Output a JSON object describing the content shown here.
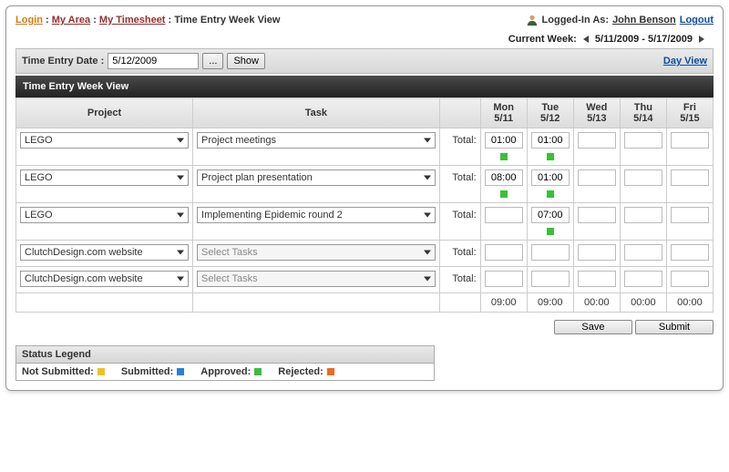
{
  "breadcrumb": {
    "login": "Login",
    "area": "My Area",
    "timesheet": "My Timesheet",
    "current": "Time Entry Week View"
  },
  "user": {
    "logged_in_as_label": "Logged-In As:",
    "name": "John Benson",
    "logout": "Logout"
  },
  "week": {
    "label": "Current Week:",
    "range": "5/11/2009 - 5/17/2009"
  },
  "datebar": {
    "label": "Time Entry Date :",
    "value": "5/12/2009",
    "browse": "...",
    "show": "Show",
    "dayview": "Day View"
  },
  "title": "Time Entry Week View",
  "headers": {
    "project": "Project",
    "task": "Task",
    "total": "Total:",
    "days": [
      {
        "d": "Mon",
        "n": "5/11"
      },
      {
        "d": "Tue",
        "n": "5/12"
      },
      {
        "d": "Wed",
        "n": "5/13"
      },
      {
        "d": "Thu",
        "n": "5/14"
      },
      {
        "d": "Fri",
        "n": "5/15"
      }
    ]
  },
  "rows": [
    {
      "project": "LEGO",
      "task": "Project meetings",
      "task_disabled": false,
      "cells": [
        "01:00",
        "01:00",
        "",
        "",
        ""
      ],
      "status": [
        "approved",
        "approved",
        "",
        "",
        ""
      ]
    },
    {
      "project": "LEGO",
      "task": "Project plan presentation",
      "task_disabled": false,
      "cells": [
        "08:00",
        "01:00",
        "",
        "",
        ""
      ],
      "status": [
        "approved",
        "approved",
        "",
        "",
        ""
      ]
    },
    {
      "project": "LEGO",
      "task": "Implementing Epidemic round 2",
      "task_disabled": false,
      "cells": [
        "",
        "07:00",
        "",
        "",
        ""
      ],
      "status": [
        "",
        "approved",
        "",
        "",
        ""
      ]
    },
    {
      "project": "ClutchDesign.com website",
      "task": "Select Tasks",
      "task_disabled": true,
      "cells": [
        "",
        "",
        "",
        "",
        ""
      ],
      "status": [
        "",
        "",
        "",
        "",
        ""
      ]
    },
    {
      "project": "ClutchDesign.com website",
      "task": "Select Tasks",
      "task_disabled": true,
      "cells": [
        "",
        "",
        "",
        "",
        ""
      ],
      "status": [
        "",
        "",
        "",
        "",
        ""
      ]
    }
  ],
  "totals": [
    "09:00",
    "09:00",
    "00:00",
    "00:00",
    "00:00"
  ],
  "actions": {
    "save": "Save",
    "submit": "Submit"
  },
  "legend": {
    "title": "Status Legend",
    "not_submitted": "Not Submitted:",
    "submitted": "Submitted:",
    "approved": "Approved:",
    "rejected": "Rejected:"
  }
}
